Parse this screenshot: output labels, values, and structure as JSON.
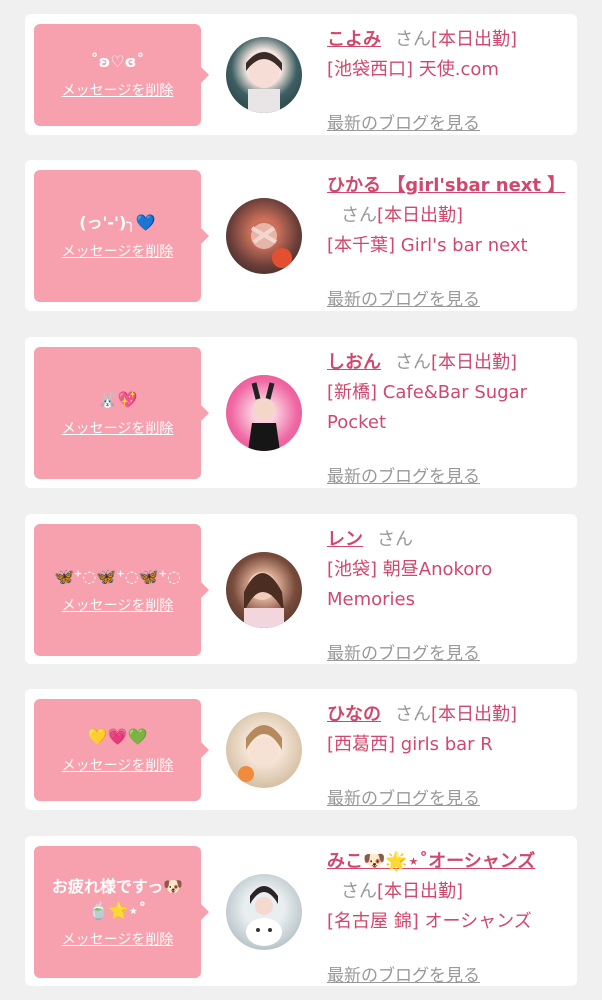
{
  "items": [
    {
      "message": "˚ʚ♡ɞ˚",
      "delete_label": "メッセージを削除",
      "name": "こよみ",
      "san": "さん",
      "status": "[本日出勤]",
      "shop": "[池袋西口] 天使.com",
      "blog_label": "最新のブログを見る"
    },
    {
      "message": "(っ'-')╮💙",
      "delete_label": "メッセージを削除",
      "name": "ひかる 【girl'sbar next 】",
      "san": "さん",
      "status": "[本日出勤]",
      "shop": "[本千葉] Girl's bar next",
      "blog_label": "最新のブログを見る"
    },
    {
      "message": "🐰💖",
      "delete_label": "メッセージを削除",
      "name": "しおん",
      "san": "さん",
      "status": "[本日出勤]",
      "shop": "[新橋] Cafe&Bar Sugar Pocket",
      "blog_label": "最新のブログを見る"
    },
    {
      "message": "🦋⁺◌🦋⁺◌🦋⁺◌",
      "delete_label": "メッセージを削除",
      "name": "レン",
      "san": "さん",
      "status": "",
      "shop": "[池袋] 朝昼Anokoro Memories",
      "blog_label": "最新のブログを見る"
    },
    {
      "message": "💛💗💚",
      "delete_label": "メッセージを削除",
      "name": "ひなの",
      "san": "さん",
      "status": "[本日出勤]",
      "shop": "[西葛西] girls bar R",
      "blog_label": "最新のブログを見る"
    },
    {
      "message": "お疲れ様ですっ🐶🍵🌟⋆˚",
      "delete_label": "メッセージを削除",
      "name": "みこ🐶🌟⋆˚オーシャンズ",
      "san": "さん",
      "status": "[本日出勤]",
      "shop": "[名古屋 錦] オーシャンズ",
      "blog_label": "最新のブログを見る"
    }
  ]
}
